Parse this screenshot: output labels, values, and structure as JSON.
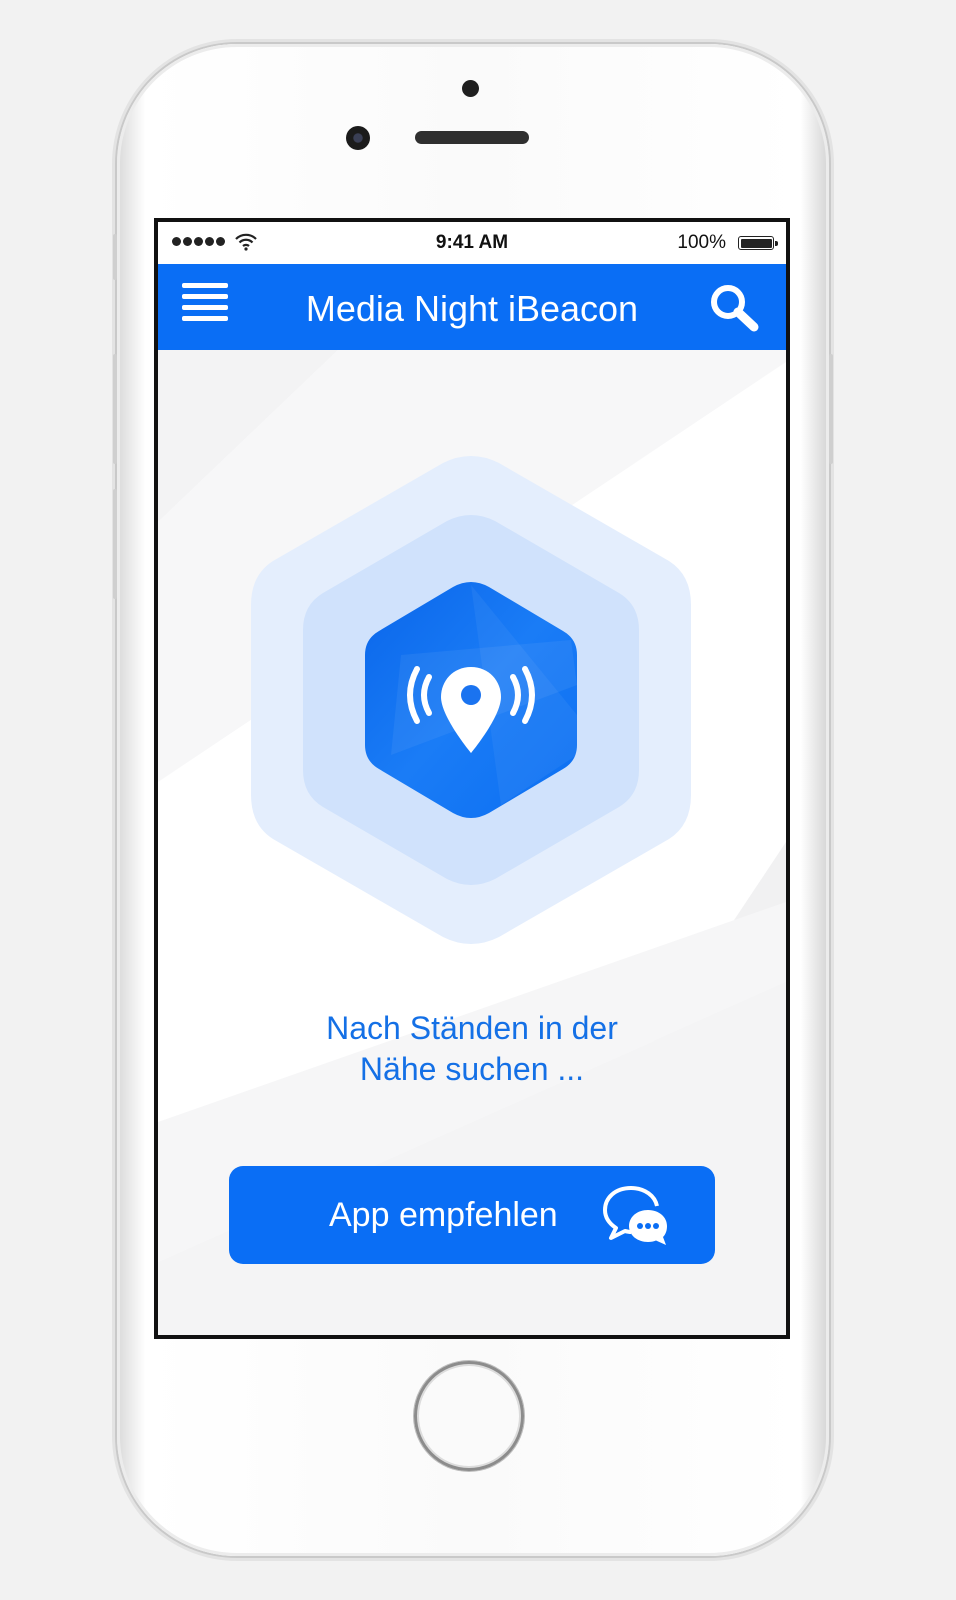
{
  "status_bar": {
    "time": "9:41 AM",
    "battery": "100%",
    "signal_icon": "signal-dots-icon",
    "wifi_icon": "wifi-icon",
    "battery_icon": "battery-icon"
  },
  "navbar": {
    "title": "Media Night iBeacon",
    "menu_icon": "hamburger-menu-icon",
    "search_icon": "search-icon"
  },
  "main": {
    "beacon_icon": "location-beacon-icon",
    "status_line1": "Nach Ständen in der",
    "status_line2": "Nähe suchen ..."
  },
  "cta": {
    "label": "App empfehlen",
    "icon": "chat-bubbles-icon"
  },
  "colors": {
    "accent": "#0a6ef5",
    "text_accent": "#1470e6",
    "hex_outer": "#e3eefd",
    "hex_middle": "#cfe1fc"
  }
}
